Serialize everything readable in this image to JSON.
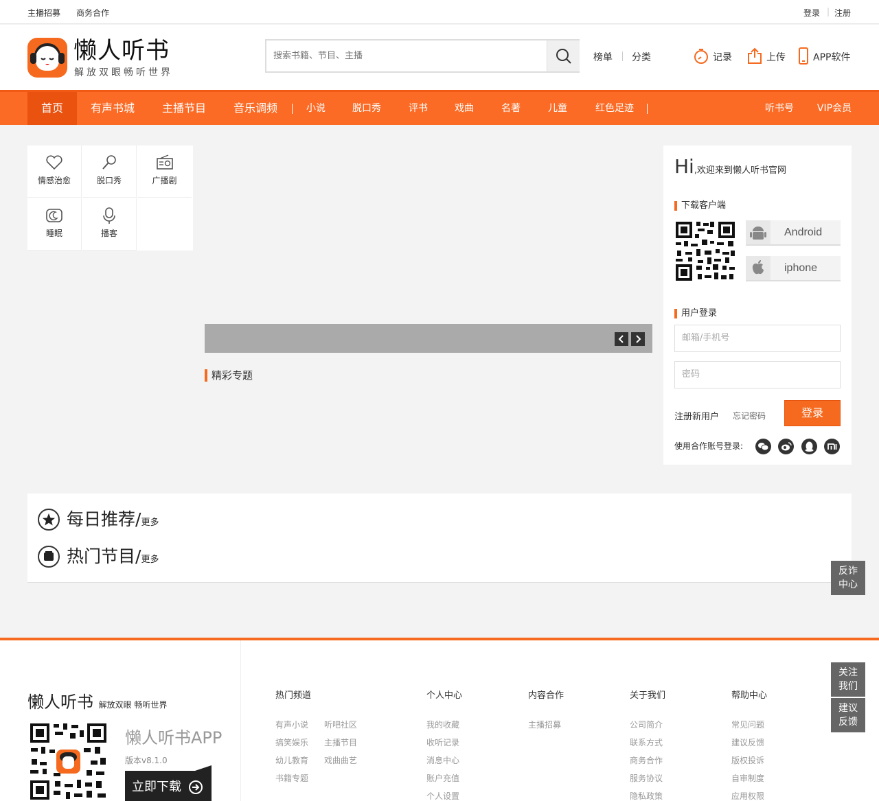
{
  "topbar": {
    "left": [
      "主播招募",
      "商务合作"
    ],
    "login": "登录",
    "register": "注册"
  },
  "brand": {
    "name": "懒人听书",
    "slogan": "解放双眼畅听世界"
  },
  "search": {
    "placeholder": "搜索书籍、节目、主播"
  },
  "header_links": {
    "rank": "榜单",
    "category": "分类",
    "history": "记录",
    "upload": "上传",
    "app": "APP软件"
  },
  "nav": {
    "primary": [
      "首页",
      "有声书城",
      "主播节目",
      "音乐调频"
    ],
    "secondary": [
      "小说",
      "脱口秀",
      "评书",
      "戏曲",
      "名著",
      "儿童",
      "红色足迹"
    ],
    "right": [
      "听书号",
      "VIP会员"
    ]
  },
  "categories": [
    {
      "label": "情感治愈",
      "icon": "heart-icon"
    },
    {
      "label": "脱口秀",
      "icon": "microphone-icon"
    },
    {
      "label": "广播剧",
      "icon": "radio-icon"
    },
    {
      "label": "睡眠",
      "icon": "moon-icon"
    },
    {
      "label": "播客",
      "icon": "podcast-mic-icon"
    }
  ],
  "topics_title": "精彩专题",
  "panel": {
    "hi": "Hi",
    "welcome": ",欢迎来到懒人听书官网",
    "download_title": "下载客户端",
    "android": "Android",
    "iphone": "iphone",
    "login_title": "用户登录",
    "account_placeholder": "邮箱/手机号",
    "password_placeholder": "密码",
    "register_link": "注册新用户",
    "forgot_link": "忘记密码",
    "login_button": "登录",
    "social_label": "使用合作账号登录:",
    "social_icons": [
      "wechat-icon",
      "weibo-icon",
      "qq-icon",
      "xiaomi-icon"
    ]
  },
  "recommend": {
    "daily": "每日推荐/",
    "hot": "热门节目/",
    "more": "更多"
  },
  "float": {
    "anti_fraud": [
      "反诈",
      "中心"
    ],
    "follow": [
      "关注",
      "我们"
    ],
    "feedback": [
      "建议",
      "反馈"
    ]
  },
  "footer": {
    "brand": "懒人听书",
    "slogan": "解放双眼 畅听世界",
    "app_name": "懒人听书APP",
    "version": "版本v8.1.0",
    "download": "立即下载",
    "columns": [
      {
        "title": "热门频道",
        "links": [
          "有声小说",
          "听吧社区",
          "搞笑娱乐",
          "主播节目",
          "幼儿教育",
          "戏曲曲艺",
          "书籍专题"
        ]
      },
      {
        "title": "个人中心",
        "links": [
          "我的收藏",
          "收听记录",
          "消息中心",
          "账户充值",
          "个人设置"
        ]
      },
      {
        "title": "内容合作",
        "links": [
          "主播招募"
        ]
      },
      {
        "title": "关于我们",
        "links": [
          "公司简介",
          "联系方式",
          "商务合作",
          "服务协议",
          "隐私政策"
        ]
      },
      {
        "title": "帮助中心",
        "links": [
          "常见问题",
          "建议反馈",
          "版权投诉",
          "自审制度",
          "应用权限"
        ]
      }
    ]
  },
  "colors": {
    "accent": "#f56a1e",
    "nav_bg": "#fb6b25",
    "nav_active": "#e9520f"
  }
}
